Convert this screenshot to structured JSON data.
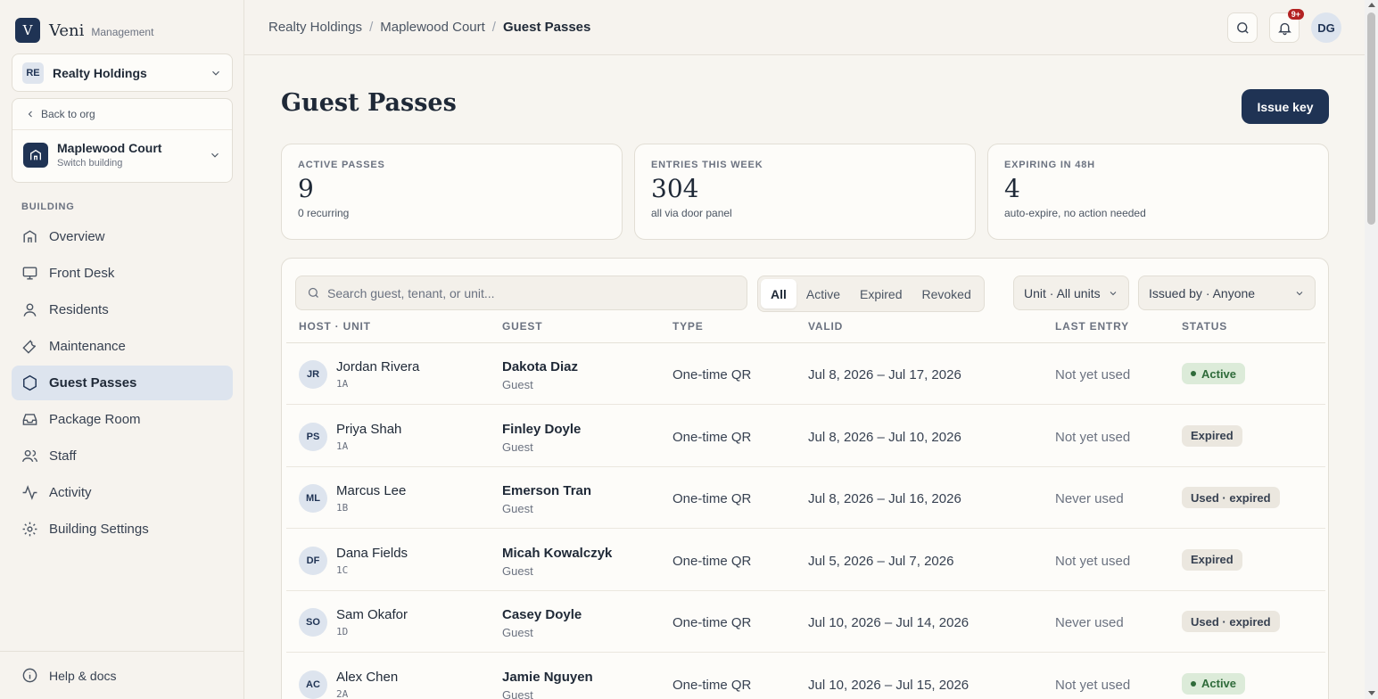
{
  "brand": {
    "letter": "V",
    "name": "Veni",
    "sub": "Management"
  },
  "org": {
    "initials": "RE",
    "name": "Realty Holdings"
  },
  "building_switcher": {
    "back_label": "Back to org",
    "name": "Maplewood Court",
    "sub": "Switch building"
  },
  "sidebar": {
    "section_label": "BUILDING",
    "items": [
      {
        "label": "Overview",
        "icon": "home-icon"
      },
      {
        "label": "Front Desk",
        "icon": "monitor-icon"
      },
      {
        "label": "Residents",
        "icon": "user-icon"
      },
      {
        "label": "Maintenance",
        "icon": "wrench-icon"
      },
      {
        "label": "Guest Passes",
        "icon": "hexagon-icon",
        "active": true
      },
      {
        "label": "Package Room",
        "icon": "inbox-icon"
      },
      {
        "label": "Staff",
        "icon": "users-icon"
      },
      {
        "label": "Activity",
        "icon": "activity-icon"
      },
      {
        "label": "Building Settings",
        "icon": "gear-icon"
      }
    ],
    "footer_label": "Help & docs"
  },
  "breadcrumb": [
    "Realty Holdings",
    "Maplewood Court",
    "Guest Passes"
  ],
  "topbar": {
    "notif_count": "9+",
    "user_initials": "DG"
  },
  "page": {
    "title": "Guest Passes",
    "issue_button": "Issue key"
  },
  "stats": [
    {
      "label": "ACTIVE PASSES",
      "value": "9",
      "sub": "0 recurring"
    },
    {
      "label": "ENTRIES THIS WEEK",
      "value": "304",
      "sub": "all via door panel"
    },
    {
      "label": "EXPIRING IN 48H",
      "value": "4",
      "sub": "auto-expire, no action needed"
    }
  ],
  "filters": {
    "search_placeholder": "Search guest, tenant, or unit...",
    "tabs": [
      "All",
      "Active",
      "Expired",
      "Revoked"
    ],
    "unit_dropdown": "Unit · All units",
    "issuer_dropdown": "Issued by · Anyone"
  },
  "table": {
    "headers": [
      "HOST · UNIT",
      "GUEST",
      "TYPE",
      "VALID",
      "LAST ENTRY",
      "STATUS"
    ],
    "rows": [
      {
        "initials": "JR",
        "host": "Jordan Rivera",
        "unit": "1A",
        "guest": "Dakota Diaz",
        "role": "Guest",
        "type": "One-time QR",
        "valid": "Jul 8, 2026 – Jul 17, 2026",
        "last_entry": "Not yet used",
        "status": "Active"
      },
      {
        "initials": "PS",
        "host": "Priya Shah",
        "unit": "1A",
        "guest": "Finley Doyle",
        "role": "Guest",
        "type": "One-time QR",
        "valid": "Jul 8, 2026 – Jul 10, 2026",
        "last_entry": "Not yet used",
        "status": "Expired"
      },
      {
        "initials": "ML",
        "host": "Marcus Lee",
        "unit": "1B",
        "guest": "Emerson Tran",
        "role": "Guest",
        "type": "One-time QR",
        "valid": "Jul 8, 2026 – Jul 16, 2026",
        "last_entry": "Never used",
        "status": "Used · expired"
      },
      {
        "initials": "DF",
        "host": "Dana Fields",
        "unit": "1C",
        "guest": "Micah Kowalczyk",
        "role": "Guest",
        "type": "One-time QR",
        "valid": "Jul 5, 2026 – Jul 7, 2026",
        "last_entry": "Not yet used",
        "status": "Expired"
      },
      {
        "initials": "SO",
        "host": "Sam Okafor",
        "unit": "1D",
        "guest": "Casey Doyle",
        "role": "Guest",
        "type": "One-time QR",
        "valid": "Jul 10, 2026 – Jul 14, 2026",
        "last_entry": "Never used",
        "status": "Used · expired"
      },
      {
        "initials": "AC",
        "host": "Alex Chen",
        "unit": "2A",
        "guest": "Jamie Nguyen",
        "role": "Guest",
        "type": "One-time QR",
        "valid": "Jul 10, 2026 – Jul 15, 2026",
        "last_entry": "Not yet used",
        "status": "Active"
      }
    ]
  },
  "colors": {
    "brand": "#1f3354",
    "active_badge_bg": "#dcebd9",
    "active_badge_fg": "#2f6b3a",
    "muted_badge_bg": "#ebe7df",
    "notif_red": "#b32222"
  }
}
